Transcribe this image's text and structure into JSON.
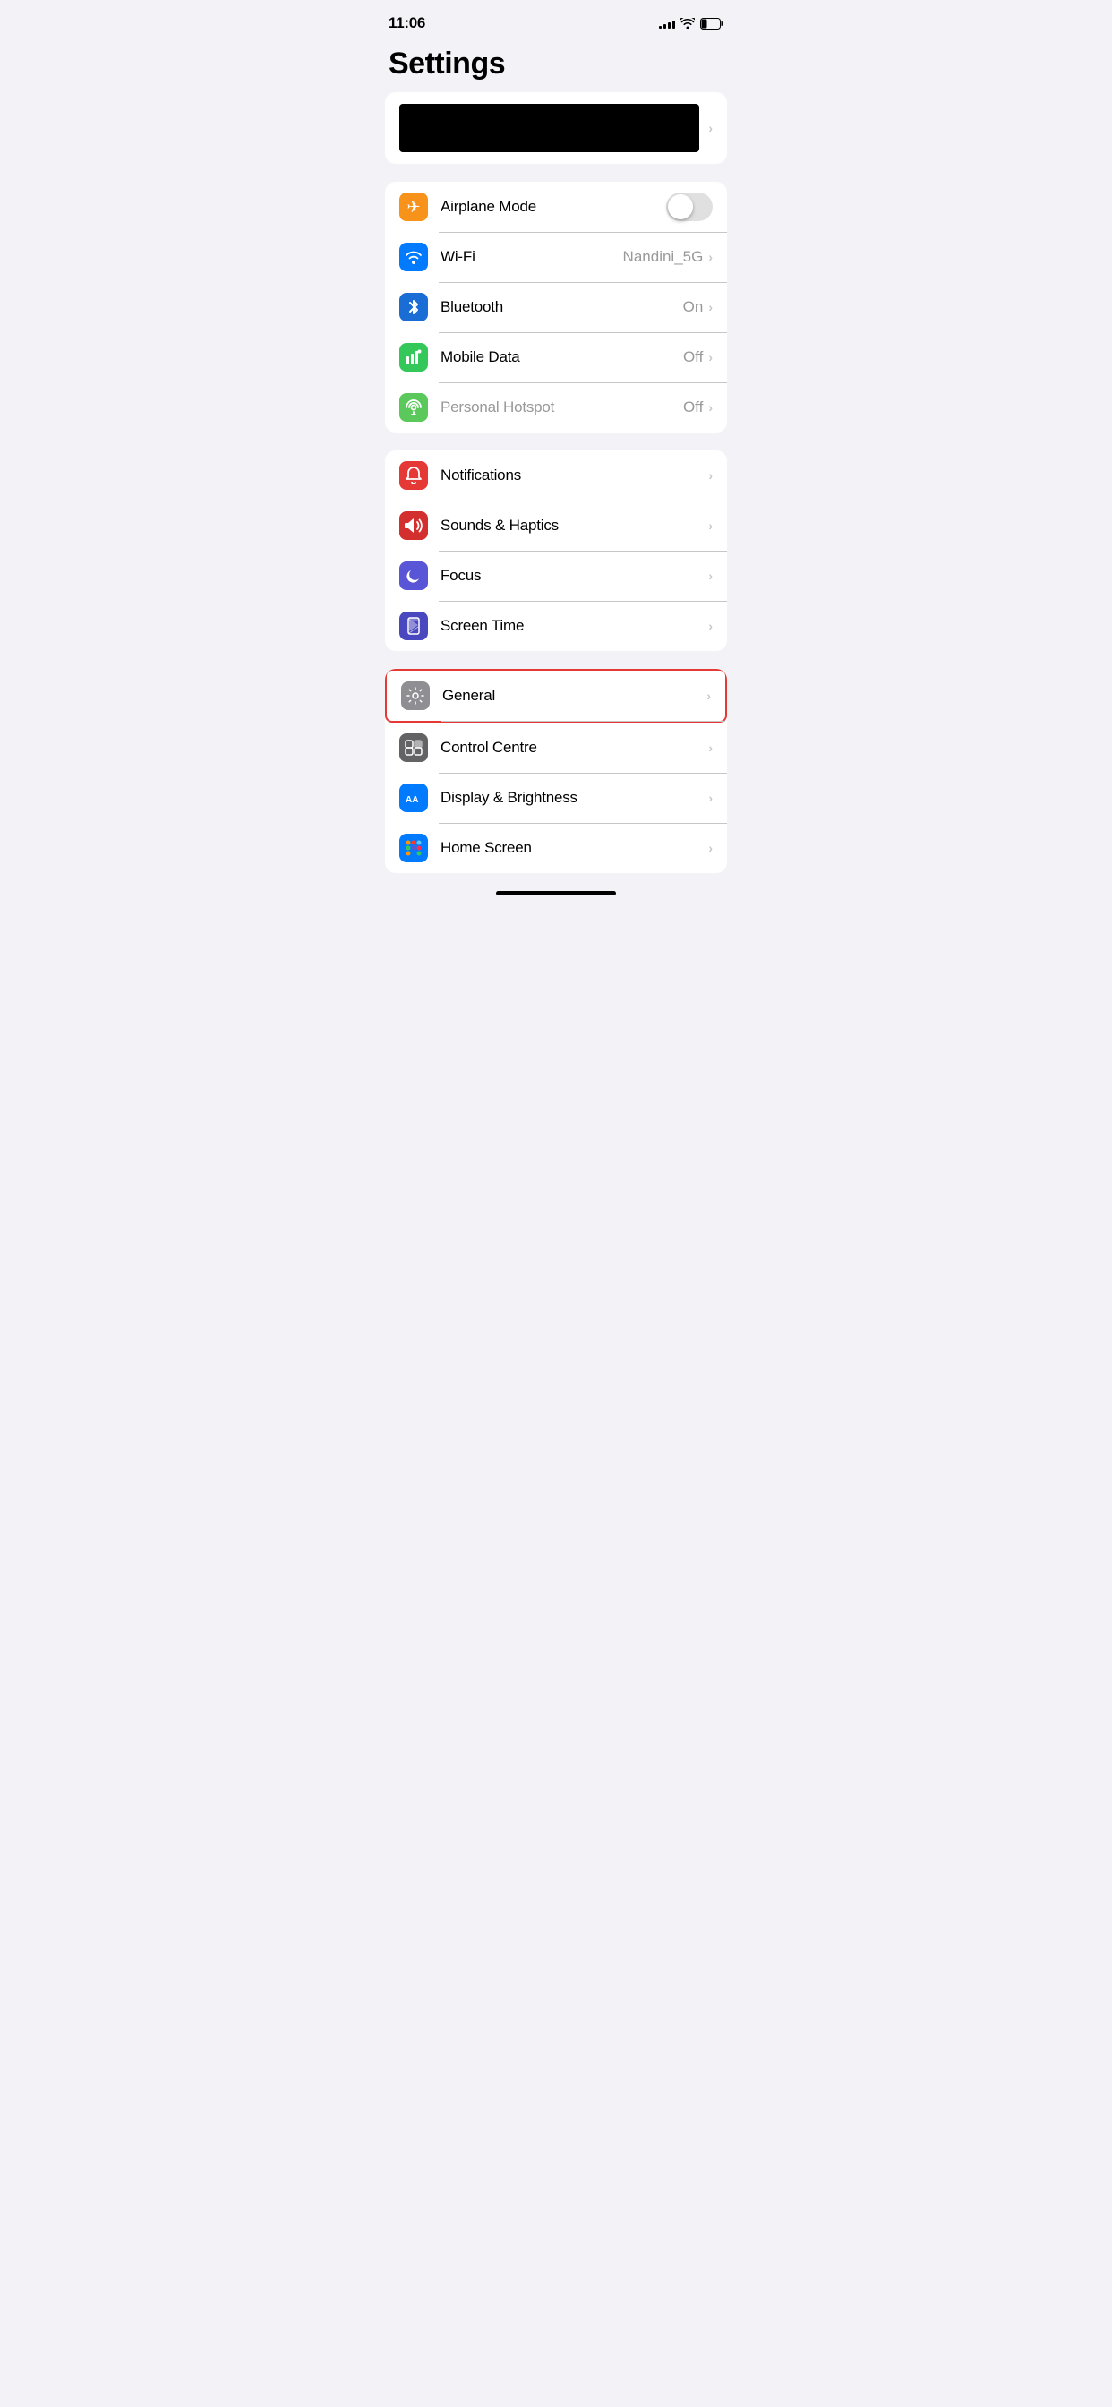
{
  "statusBar": {
    "time": "11:06",
    "signalBars": [
      3,
      5,
      7,
      9,
      11
    ],
    "batteryLevel": 30
  },
  "pageTitle": "Settings",
  "profileRow": {
    "chevron": "›"
  },
  "group1": {
    "items": [
      {
        "id": "airplane-mode",
        "label": "Airplane Mode",
        "iconBg": "icon-orange",
        "iconSymbol": "✈",
        "hasToggle": true,
        "toggleOn": false,
        "value": "",
        "hasChevron": false
      },
      {
        "id": "wifi",
        "label": "Wi-Fi",
        "iconBg": "icon-blue",
        "iconSymbol": "wifi",
        "hasToggle": false,
        "value": "Nandini_5G",
        "hasChevron": true
      },
      {
        "id": "bluetooth",
        "label": "Bluetooth",
        "iconBg": "icon-blue-dark",
        "iconSymbol": "bluetooth",
        "hasToggle": false,
        "value": "On",
        "hasChevron": true
      },
      {
        "id": "mobile-data",
        "label": "Mobile Data",
        "iconBg": "icon-green",
        "iconSymbol": "signal",
        "hasToggle": false,
        "value": "Off",
        "hasChevron": true
      },
      {
        "id": "personal-hotspot",
        "label": "Personal Hotspot",
        "iconBg": "icon-green-light",
        "iconSymbol": "hotspot",
        "hasToggle": false,
        "value": "Off",
        "hasChevron": true,
        "labelDisabled": true
      }
    ]
  },
  "group2": {
    "items": [
      {
        "id": "notifications",
        "label": "Notifications",
        "iconBg": "icon-red",
        "iconSymbol": "bell",
        "hasToggle": false,
        "value": "",
        "hasChevron": true
      },
      {
        "id": "sounds-haptics",
        "label": "Sounds & Haptics",
        "iconBg": "icon-red-dark",
        "iconSymbol": "sound",
        "hasToggle": false,
        "value": "",
        "hasChevron": true
      },
      {
        "id": "focus",
        "label": "Focus",
        "iconBg": "icon-purple",
        "iconSymbol": "moon",
        "hasToggle": false,
        "value": "",
        "hasChevron": true
      },
      {
        "id": "screen-time",
        "label": "Screen Time",
        "iconBg": "icon-purple-dark",
        "iconSymbol": "hourglass",
        "hasToggle": false,
        "value": "",
        "hasChevron": true
      }
    ]
  },
  "group3": {
    "items": [
      {
        "id": "general",
        "label": "General",
        "iconBg": "icon-gray",
        "iconSymbol": "gear",
        "hasToggle": false,
        "value": "",
        "hasChevron": true,
        "highlighted": true
      },
      {
        "id": "control-centre",
        "label": "Control Centre",
        "iconBg": "icon-gray-dark",
        "iconSymbol": "sliders",
        "hasToggle": false,
        "value": "",
        "hasChevron": true
      },
      {
        "id": "display-brightness",
        "label": "Display & Brightness",
        "iconBg": "icon-blue",
        "iconSymbol": "AA",
        "hasToggle": false,
        "value": "",
        "hasChevron": true
      },
      {
        "id": "home-screen",
        "label": "Home Screen",
        "iconBg": "icon-blue",
        "iconSymbol": "grid",
        "hasToggle": false,
        "value": "",
        "hasChevron": true
      }
    ]
  }
}
